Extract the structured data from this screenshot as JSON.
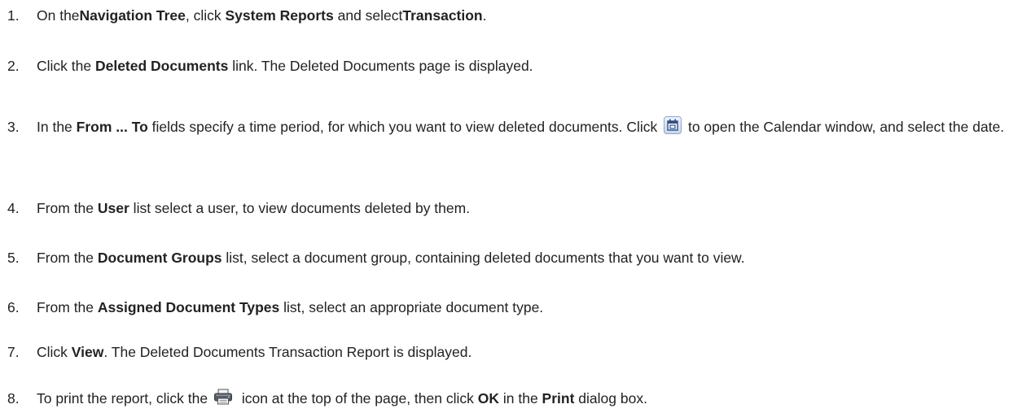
{
  "steps": [
    {
      "number": "1.",
      "segments": [
        {
          "t": "On the"
        },
        {
          "t": "Navigation Tree",
          "b": true
        },
        {
          "t": ", click "
        },
        {
          "t": "System Reports",
          "b": true
        },
        {
          "t": " and select"
        },
        {
          "t": "Transaction",
          "b": true
        },
        {
          "t": "."
        }
      ]
    },
    {
      "number": "2.",
      "segments": [
        {
          "t": "Click the "
        },
        {
          "t": "Deleted Documents",
          "b": true
        },
        {
          "t": " link. The Deleted Documents page is displayed."
        }
      ]
    },
    {
      "number": "3.",
      "segments": [
        {
          "t": "In the "
        },
        {
          "t": "From ... To",
          "b": true
        },
        {
          "t": " fields specify a time period, for which you want to view deleted documents. Click "
        },
        {
          "icon": "calendar-icon"
        },
        {
          "t": " to open the Calendar window, and select the date."
        }
      ]
    },
    {
      "number": "4.",
      "segments": [
        {
          "t": "From the "
        },
        {
          "t": "User",
          "b": true
        },
        {
          "t": " list select a user, to view documents deleted by them."
        }
      ]
    },
    {
      "number": "5.",
      "segments": [
        {
          "t": "From the "
        },
        {
          "t": "Document Groups",
          "b": true
        },
        {
          "t": " list, select a document group, containing deleted documents that you want to view."
        }
      ]
    },
    {
      "number": "6.",
      "segments": [
        {
          "t": "From the "
        },
        {
          "t": "Assigned Document Types",
          "b": true
        },
        {
          "t": " list, select an appropriate document type."
        }
      ]
    },
    {
      "number": "7.",
      "segments": [
        {
          "t": "Click "
        },
        {
          "t": "View",
          "b": true
        },
        {
          "t": ". The Deleted Documents Transaction Report is displayed."
        }
      ]
    },
    {
      "number": "8.",
      "segments": [
        {
          "t": "To print the report, click the "
        },
        {
          "icon": "print-icon"
        },
        {
          "t": " icon at the top of the page, then click "
        },
        {
          "t": "OK",
          "b": true
        },
        {
          "t": " in the "
        },
        {
          "t": "Print",
          "b": true
        },
        {
          "t": " dialog box."
        }
      ]
    }
  ]
}
